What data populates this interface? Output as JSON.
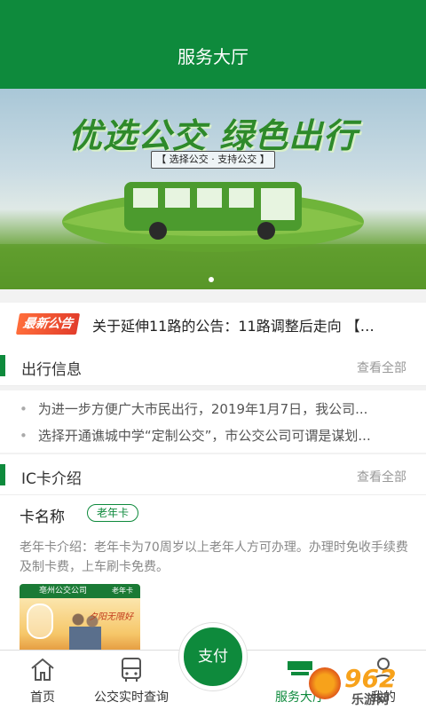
{
  "header": {
    "title": "服务大厅"
  },
  "banner": {
    "slogan": "优选公交 绿色出行",
    "sub": "【 选择公交 · 支持公交 】"
  },
  "notice": {
    "tag": "最新公告",
    "text": "关于延伸11路的公告：11路调整后走向 【…"
  },
  "travel": {
    "title": "出行信息",
    "more": "查看全部",
    "items": [
      "为进一步方便广大市民出行，2019年1月7日，我公司...",
      "选择开通谯城中学“定制公交”，市公交公司可谓是谋划..."
    ]
  },
  "ic": {
    "title": "IC卡介绍",
    "more": "查看全部",
    "name_label": "卡名称",
    "card_type": "老年卡",
    "desc": "老年卡介绍：老年卡为70周岁以上老年人方可办理。办理时免收手续费及制卡费，上车刷卡免费。",
    "card_image": {
      "company": "亳州公交公司",
      "type": "老年卡",
      "script": "夕阳无限好"
    }
  },
  "tabbar": {
    "tabs": [
      {
        "label": "首页",
        "icon": "home-icon"
      },
      {
        "label": "公交实时查询",
        "icon": "bus-icon"
      },
      {
        "label": "服务大厅",
        "icon": "service-hall-icon"
      },
      {
        "label": "我的",
        "icon": "user-icon"
      }
    ],
    "pay": "支付"
  },
  "watermark": {
    "num": "962",
    "site": "乐游网"
  },
  "colors": {
    "primary": "#0e8a3c"
  }
}
